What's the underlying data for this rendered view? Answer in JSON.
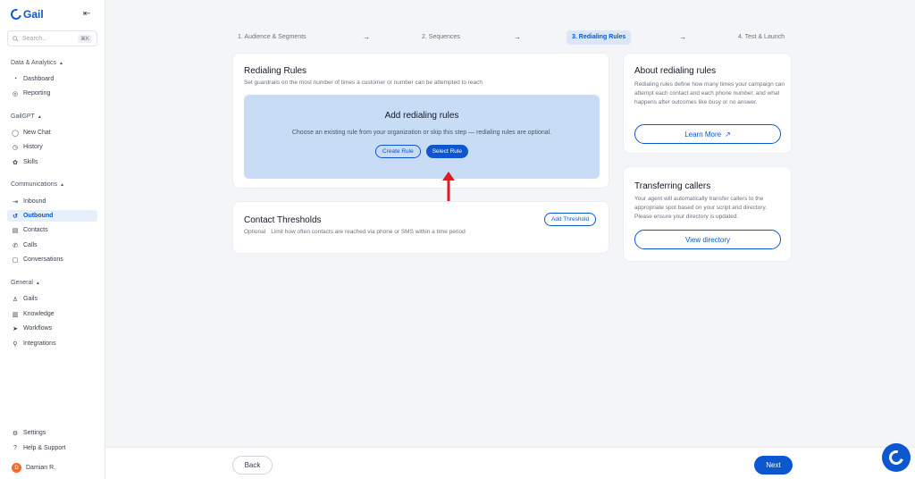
{
  "brand": {
    "name": "Gail"
  },
  "search": {
    "placeholder": "Search...",
    "shortcut": "⌘K"
  },
  "sidebar": {
    "sections": [
      {
        "title": "Data & Analytics",
        "items": [
          {
            "label": "Dashboard",
            "icon": "dashboard-icon"
          },
          {
            "label": "Reporting",
            "icon": "reporting-icon"
          }
        ]
      },
      {
        "title": "GailGPT",
        "items": [
          {
            "label": "New Chat",
            "icon": "chat-icon"
          },
          {
            "label": "History",
            "icon": "clock-icon"
          },
          {
            "label": "Skills",
            "icon": "skills-icon"
          }
        ]
      },
      {
        "title": "Communications",
        "items": [
          {
            "label": "Inbound",
            "icon": "inbound-icon"
          },
          {
            "label": "Outbound",
            "icon": "outbound-icon",
            "active": true
          },
          {
            "label": "Contacts",
            "icon": "contacts-icon"
          },
          {
            "label": "Calls",
            "icon": "phone-icon"
          },
          {
            "label": "Conversations",
            "icon": "conversations-icon"
          }
        ]
      },
      {
        "title": "General",
        "items": [
          {
            "label": "Gails",
            "icon": "gails-icon"
          },
          {
            "label": "Knowledge",
            "icon": "book-icon"
          },
          {
            "label": "Workflows",
            "icon": "workflows-icon"
          },
          {
            "label": "Integrations",
            "icon": "integrations-icon"
          }
        ]
      }
    ],
    "bottom": [
      {
        "label": "Settings",
        "icon": "gear-icon"
      },
      {
        "label": "Help & Support",
        "icon": "help-icon"
      }
    ],
    "user": {
      "name": "Damian R.",
      "initial": "D"
    }
  },
  "stepper": {
    "steps": [
      "1. Audience & Segments",
      "2. Sequences",
      "3. Redialing Rules",
      "4. Test & Launch"
    ],
    "active_index": 2,
    "arrow": "→"
  },
  "redialing": {
    "title": "Redialing Rules",
    "subtitle": "Set guardrails on the most number of times a customer or number can be attempted to reach",
    "box_title": "Add redialing rules",
    "box_subtitle": "Choose an existing rule from your organization or skip this step — redialing rules are optional.",
    "create_label": "Create Rule",
    "select_label": "Select Rule"
  },
  "thresholds": {
    "title": "Contact Thresholds",
    "optional": "Optional",
    "subtitle": "Limit how often contacts are reached via phone or SMS within a time period",
    "add_label": "Add Threshold"
  },
  "about": {
    "title": "About redialing rules",
    "body": "Redialing rules define how many times your campaign can attempt each contact and each phone number, and what happens after outcomes like busy or no answer.",
    "learn_more": "Learn More"
  },
  "transfer": {
    "title": "Transferring callers",
    "body": "Your agent will automatically transfer callers to the appropriate spot based on your script and directory. Please ensure your directory is updated.",
    "view_label": "View directory"
  },
  "footer": {
    "back": "Back",
    "next": "Next"
  },
  "colors": {
    "accent": "#0b57d0",
    "annotation_arrow": "#e01b24",
    "box_bg": "#c9dcf5"
  }
}
